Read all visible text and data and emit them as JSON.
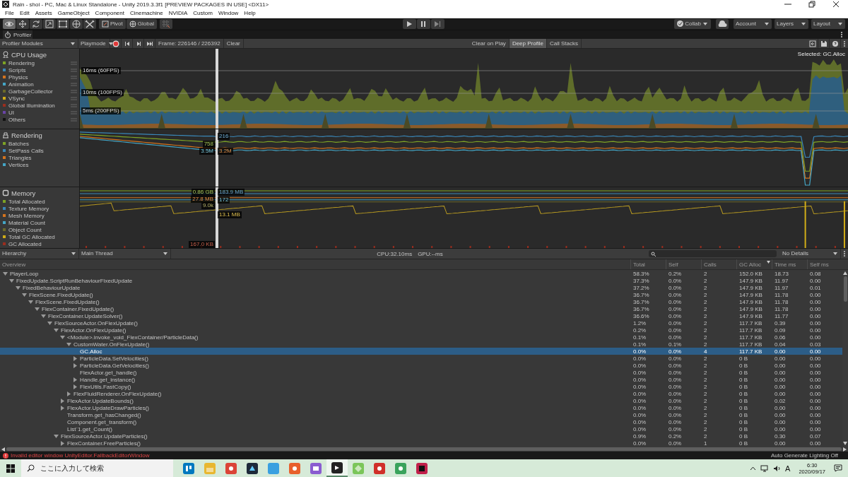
{
  "window": {
    "title": "Rain - shoi - PC, Mac & Linux Standalone - Unity 2019.3.3f1 [PREVIEW PACKAGES IN USE] <DX11>"
  },
  "menu": [
    "File",
    "Edit",
    "Assets",
    "GameObject",
    "Component",
    "Cinemachine",
    "NVIDIA",
    "Custom",
    "Window",
    "Help"
  ],
  "toolbar": {
    "tools": [
      {
        "selected": true
      },
      {
        "selected": false
      },
      {
        "selected": false
      },
      {
        "selected": false
      },
      {
        "selected": false
      },
      {
        "selected": false
      },
      {
        "selected": false
      }
    ],
    "pivot": "Pivot",
    "global": "Global",
    "collab": "Collab",
    "account": "Account",
    "layers": "Layers",
    "layout": "Layout"
  },
  "profiler": {
    "tab": "Profiler",
    "modules_dropdown": "Profiler Modules",
    "target": "Playmode",
    "record": true,
    "frame": "Frame: 226146 / 226392",
    "clear": "Clear",
    "toggles": [
      {
        "label": "Clear on Play",
        "on": false
      },
      {
        "label": "Deep Profile",
        "on": true
      },
      {
        "label": "Call Stacks",
        "on": false
      }
    ],
    "selected_label": "Selected: GC.Alloc",
    "modules": [
      {
        "kind": "cpu",
        "title": "CPU Usage",
        "legend": [
          {
            "label": "Rendering",
            "color": "#7ea325"
          },
          {
            "label": "Scripts",
            "color": "#3a87b8"
          },
          {
            "label": "Physics",
            "color": "#d4731e"
          },
          {
            "label": "Animation",
            "color": "#44a6c6"
          },
          {
            "label": "GarbageCollector",
            "color": "#6c6a2b"
          },
          {
            "label": "VSync",
            "color": "#d0ac18"
          },
          {
            "label": "Global Illumination",
            "color": "#9c2d1e"
          },
          {
            "label": "UI",
            "color": "#6a44a6"
          },
          {
            "label": "Others",
            "color": "#111111"
          }
        ],
        "labels": [
          "16ms (60FPS)",
          "10ms (100FPS)",
          "5ms (200FPS)"
        ]
      },
      {
        "kind": "rendering",
        "title": "Rendering",
        "legend": [
          {
            "label": "Batches",
            "color": "#7ea325"
          },
          {
            "label": "SetPass Calls",
            "color": "#3a87b8"
          },
          {
            "label": "Triangles",
            "color": "#d4731e"
          },
          {
            "label": "Vertices",
            "color": "#44a6c6"
          }
        ],
        "labels": [
          "216",
          "758",
          "3.5M",
          "3.2M"
        ]
      },
      {
        "kind": "memory",
        "title": "Memory",
        "legend": [
          {
            "label": "Total Allocated",
            "color": "#7ea325"
          },
          {
            "label": "Texture Memory",
            "color": "#3a87b8"
          },
          {
            "label": "Mesh Memory",
            "color": "#d4731e"
          },
          {
            "label": "Material Count",
            "color": "#44a6c6"
          },
          {
            "label": "Object Count",
            "color": "#6c6a2b"
          },
          {
            "label": "Total GC Allocated",
            "color": "#d0ac18"
          },
          {
            "label": "GC Allocated",
            "color": "#9c2d1e"
          }
        ],
        "labels": [
          "0.86 GB",
          "183.9 MB",
          "27.8 MB",
          "172",
          "9.0k",
          "13.1 MB",
          "167.0 KB"
        ]
      }
    ]
  },
  "hierarchy": {
    "view": "Hierarchy",
    "thread": "Main Thread",
    "cpu": "CPU:32.10ms",
    "gpu": "GPU:--ms",
    "details": "No Details",
    "columns": [
      {
        "label": "Overview",
        "sorted": false
      },
      {
        "label": "Total",
        "sorted": false
      },
      {
        "label": "Self",
        "sorted": false
      },
      {
        "label": "Calls",
        "sorted": false
      },
      {
        "label": "GC Alloc",
        "sorted": true
      },
      {
        "label": "Time ms",
        "sorted": false
      },
      {
        "label": "Self ms",
        "sorted": false
      }
    ],
    "rows": [
      {
        "name": "PlayerLoop",
        "expanded": true,
        "selected": false,
        "values": [
          "58.3%",
          "0.2%",
          "2",
          "152.0 KB",
          "18.73",
          "0.08"
        ],
        "children": [
          {
            "name": "FixedUpdate.ScriptRunBehaviourFixedUpdate",
            "expanded": true,
            "selected": false,
            "values": [
              "37.3%",
              "0.0%",
              "2",
              "147.9 KB",
              "11.97",
              "0.00"
            ],
            "children": [
              {
                "name": "FixedBehaviourUpdate",
                "expanded": true,
                "selected": false,
                "values": [
                  "37.2%",
                  "0.0%",
                  "2",
                  "147.9 KB",
                  "11.97",
                  "0.01"
                ],
                "children": [
                  {
                    "name": "FlexScene.FixedUpdate()",
                    "expanded": true,
                    "selected": false,
                    "values": [
                      "36.7%",
                      "0.0%",
                      "2",
                      "147.9 KB",
                      "11.78",
                      "0.00"
                    ],
                    "children": [
                      {
                        "name": "FlexScene.FixedUpdate()",
                        "expanded": true,
                        "selected": false,
                        "values": [
                          "36.7%",
                          "0.0%",
                          "2",
                          "147.9 KB",
                          "11.78",
                          "0.00"
                        ],
                        "children": [
                          {
                            "name": "FlexContainer.FixedUpdate()",
                            "expanded": true,
                            "selected": false,
                            "values": [
                              "36.7%",
                              "0.0%",
                              "2",
                              "147.9 KB",
                              "11.78",
                              "0.00"
                            ],
                            "children": [
                              {
                                "name": "FlexContainer.UpdateSolver()",
                                "expanded": true,
                                "selected": false,
                                "values": [
                                  "36.6%",
                                  "0.0%",
                                  "2",
                                  "147.9 KB",
                                  "11.77",
                                  "0.00"
                                ],
                                "children": [
                                  {
                                    "name": "FlexSourceActor.OnFlexUpdate()",
                                    "expanded": true,
                                    "selected": false,
                                    "values": [
                                      "1.2%",
                                      "0.0%",
                                      "2",
                                      "117.7 KB",
                                      "0.39",
                                      "0.00"
                                    ],
                                    "children": [
                                      {
                                        "name": "FlexActor.OnFlexUpdate()",
                                        "expanded": true,
                                        "selected": false,
                                        "values": [
                                          "0.2%",
                                          "0.0%",
                                          "2",
                                          "117.7 KB",
                                          "0.09",
                                          "0.00"
                                        ],
                                        "children": [
                                          {
                                            "name": "<Module>.invoke_void_FlexContainer/ParticleData()",
                                            "expanded": true,
                                            "selected": false,
                                            "values": [
                                              "0.1%",
                                              "0.0%",
                                              "2",
                                              "117.7 KB",
                                              "0.06",
                                              "0.00"
                                            ],
                                            "children": [
                                              {
                                                "name": "CustomWater.OnFlexUpdate()",
                                                "expanded": true,
                                                "selected": false,
                                                "values": [
                                                  "0.1%",
                                                  "0.1%",
                                                  "2",
                                                  "117.7 KB",
                                                  "0.04",
                                                  "0.03"
                                                ],
                                                "children": [
                                                  {
                                                    "name": "GC.Alloc",
                                                    "selected": true,
                                                    "values": [
                                                      "0.0%",
                                                      "0.0%",
                                                      "4",
                                                      "117.7 KB",
                                                      "0.00",
                                                      "0.00"
                                                    ]
                                                  },
                                                  {
                                                    "name": "ParticleData.SetVelocities()",
                                                    "expanded": false,
                                                    "selected": false,
                                                    "values": [
                                                      "0.0%",
                                                      "0.0%",
                                                      "2",
                                                      "0 B",
                                                      "0.00",
                                                      "0.00"
                                                    ]
                                                  },
                                                  {
                                                    "name": "ParticleData.GetVelocities()",
                                                    "expanded": false,
                                                    "selected": false,
                                                    "values": [
                                                      "0.0%",
                                                      "0.0%",
                                                      "2",
                                                      "0 B",
                                                      "0.00",
                                                      "0.00"
                                                    ]
                                                  },
                                                  {
                                                    "name": "FlexActor.get_handle()",
                                                    "selected": false,
                                                    "values": [
                                                      "0.0%",
                                                      "0.0%",
                                                      "2",
                                                      "0 B",
                                                      "0.00",
                                                      "0.00"
                                                    ]
                                                  },
                                                  {
                                                    "name": "Handle.get_instance()",
                                                    "expanded": false,
                                                    "selected": false,
                                                    "values": [
                                                      "0.0%",
                                                      "0.0%",
                                                      "2",
                                                      "0 B",
                                                      "0.00",
                                                      "0.00"
                                                    ]
                                                  },
                                                  {
                                                    "name": "FlexUtils.FastCopy()",
                                                    "expanded": false,
                                                    "selected": false,
                                                    "values": [
                                                      "0.0%",
                                                      "0.0%",
                                                      "2",
                                                      "0 B",
                                                      "0.00",
                                                      "0.00"
                                                    ]
                                                  }
                                                ]
                                              },
                                              {
                                                "name": "FlexFluidRenderer.OnFlexUpdate()",
                                                "expanded": false,
                                                "selected": false,
                                                "values": [
                                                  "0.0%",
                                                  "0.0%",
                                                  "2",
                                                  "0 B",
                                                  "0.00",
                                                  "0.00"
                                                ]
                                              }
                                            ]
                                          },
                                          {
                                            "name": "FlexActor.UpdateBounds()",
                                            "expanded": false,
                                            "selected": false,
                                            "values": [
                                              "0.0%",
                                              "0.0%",
                                              "2",
                                              "0 B",
                                              "0.02",
                                              "0.00"
                                            ]
                                          },
                                          {
                                            "name": "FlexActor.UpdateDrawParticles()",
                                            "expanded": false,
                                            "selected": false,
                                            "values": [
                                              "0.0%",
                                              "0.0%",
                                              "2",
                                              "0 B",
                                              "0.00",
                                              "0.00"
                                            ]
                                          },
                                          {
                                            "name": "Transform.get_hasChanged()",
                                            "selected": false,
                                            "values": [
                                              "0.0%",
                                              "0.0%",
                                              "2",
                                              "0 B",
                                              "0.00",
                                              "0.00"
                                            ]
                                          },
                                          {
                                            "name": "Component.get_transform()",
                                            "selected": false,
                                            "values": [
                                              "0.0%",
                                              "0.0%",
                                              "2",
                                              "0 B",
                                              "0.00",
                                              "0.00"
                                            ]
                                          },
                                          {
                                            "name": "List`1.get_Count()",
                                            "selected": false,
                                            "values": [
                                              "0.0%",
                                              "0.0%",
                                              "2",
                                              "0 B",
                                              "0.00",
                                              "0.00"
                                            ]
                                          }
                                        ]
                                      },
                                      {
                                        "name": "FlexSourceActor.UpdateParticles()",
                                        "expanded": true,
                                        "selected": false,
                                        "values": [
                                          "0.9%",
                                          "0.2%",
                                          "2",
                                          "0 B",
                                          "0.30",
                                          "0.07"
                                        ],
                                        "children": [
                                          {
                                            "name": "FlexContainer.FreeParticles()",
                                            "expanded": false,
                                            "selected": false,
                                            "values": [
                                              "0.0%",
                                              "0.0%",
                                              "1",
                                              "0 B",
                                              "0.00",
                                              "0.00"
                                            ]
                                          }
                                        ]
                                      }
                                    ]
                                  }
                                ]
                              }
                            ]
                          }
                        ]
                      }
                    ]
                  }
                ]
              }
            ]
          }
        ]
      }
    ]
  },
  "status_bar": {
    "error": "Invalid editor window UnityEditor.FallbackEditorWindow",
    "lighting": "Auto Generate Lighting Off"
  },
  "taskbar": {
    "search": {
      "placeholder": "ここに入力して検索"
    },
    "apps": [
      {
        "color": "#0079bf",
        "selected": false
      },
      {
        "color": "#e8b730",
        "selected": false
      },
      {
        "color": "#db4437",
        "selected": false
      },
      {
        "color": "#1e2a3a",
        "selected": false
      },
      {
        "color": "#3aa0e0",
        "selected": false
      },
      {
        "color": "#e8602c",
        "selected": false
      },
      {
        "color": "#8a5cd0",
        "selected": false
      },
      {
        "color": "#222222",
        "selected": true
      },
      {
        "color": "#7bc65a",
        "selected": false
      },
      {
        "color": "#d0302a",
        "selected": false
      },
      {
        "color": "#3aa35c",
        "selected": false
      },
      {
        "color": "#c0204a",
        "selected": false
      }
    ],
    "ime": "A",
    "time": "6:30",
    "date": "2020/09/17"
  }
}
